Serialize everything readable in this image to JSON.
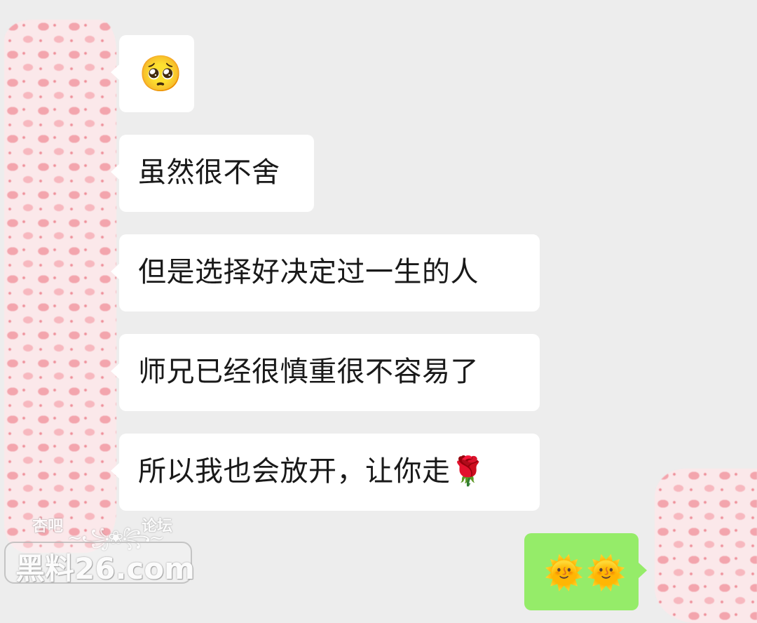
{
  "chat": {
    "messages": [
      {
        "side": "received",
        "type": "emoji",
        "emoji": "🥺",
        "emoji_name": "pleading-face-icon"
      },
      {
        "side": "received",
        "type": "text",
        "text": "虽然很不舍"
      },
      {
        "side": "received",
        "type": "text",
        "text": "但是选择好决定过一生的人"
      },
      {
        "side": "received",
        "type": "text",
        "text": "师兄已经很慎重很不容易了"
      },
      {
        "side": "received",
        "type": "text",
        "text": "所以我也会放开，让你走",
        "trailing_emoji": "🌹",
        "trailing_emoji_name": "rose-icon"
      },
      {
        "side": "sent",
        "type": "emoji",
        "emojis": [
          "🌞",
          "🌞"
        ],
        "emoji_name": "sun-face-icon"
      }
    ]
  },
  "watermark": {
    "top_left": "杏吧",
    "top_right": "论坛",
    "main": "黑料26.com"
  },
  "colors": {
    "background": "#ededed",
    "received_bubble": "#ffffff",
    "sent_bubble": "#95ec69",
    "text": "#191919",
    "avatar_heart": "#f3a5ad"
  }
}
